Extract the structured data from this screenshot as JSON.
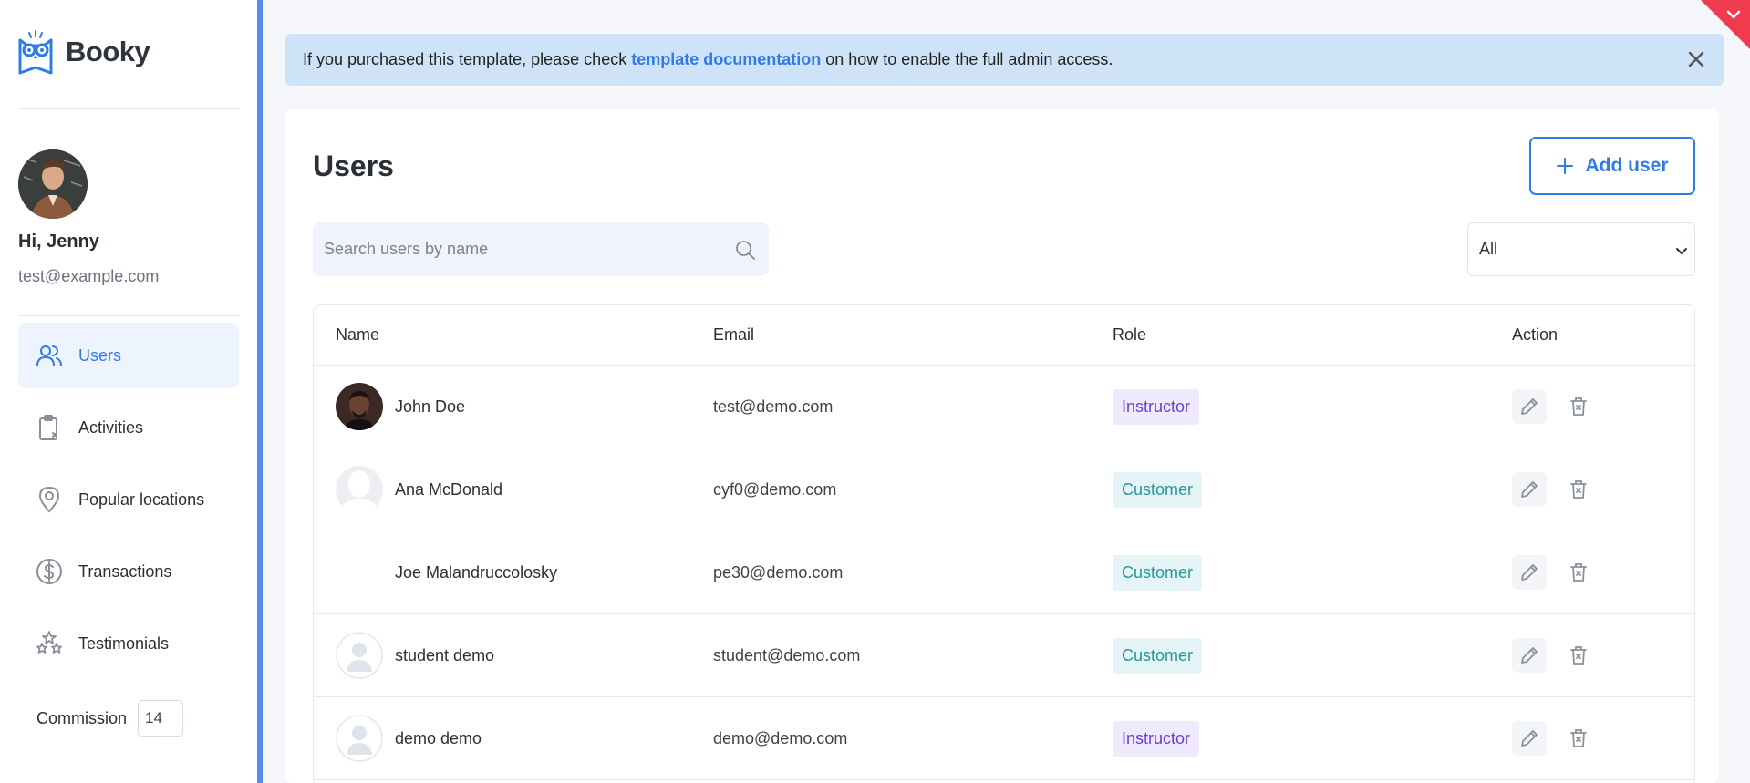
{
  "app": {
    "name": "Booky"
  },
  "profile": {
    "greeting": "Hi, Jenny",
    "email": "test@example.com"
  },
  "nav": [
    {
      "label": "Users",
      "icon": "users-icon",
      "active": true
    },
    {
      "label": "Activities",
      "icon": "clipboard-icon",
      "active": false
    },
    {
      "label": "Popular locations",
      "icon": "map-pin-icon",
      "active": false
    },
    {
      "label": "Transactions",
      "icon": "dollar-circle-icon",
      "active": false
    },
    {
      "label": "Testimonials",
      "icon": "stars-icon",
      "active": false
    }
  ],
  "commission": {
    "label": "Commission",
    "value": "14"
  },
  "alert": {
    "before": "If you purchased this template, please check",
    "link": "template documentation",
    "after": "on how to enable the full admin access."
  },
  "page": {
    "title": "Users",
    "add_label": "Add user"
  },
  "search": {
    "placeholder": "Search users by name"
  },
  "filter": {
    "selected": "All"
  },
  "table": {
    "headers": [
      "Name",
      "Email",
      "Role",
      "Action"
    ],
    "rows": [
      {
        "name": "John Doe",
        "email": "test@demo.com",
        "role": "Instructor",
        "avatar": "photo"
      },
      {
        "name": "Ana McDonald",
        "email": "cyf0@demo.com",
        "role": "Customer",
        "avatar": "placeholder"
      },
      {
        "name": "Joe Malandruccolosky",
        "email": "pe30@demo.com",
        "role": "Customer",
        "avatar": "none"
      },
      {
        "name": "student demo",
        "email": "student@demo.com",
        "role": "Customer",
        "avatar": "placeholder-light"
      },
      {
        "name": "demo demo",
        "email": "demo@demo.com",
        "role": "Instructor",
        "avatar": "placeholder-light"
      }
    ]
  },
  "colors": {
    "accent": "#2f7be8",
    "instructor": "#6b3fd6",
    "customer": "#26979c",
    "alert_bg": "#cfe3f8"
  }
}
